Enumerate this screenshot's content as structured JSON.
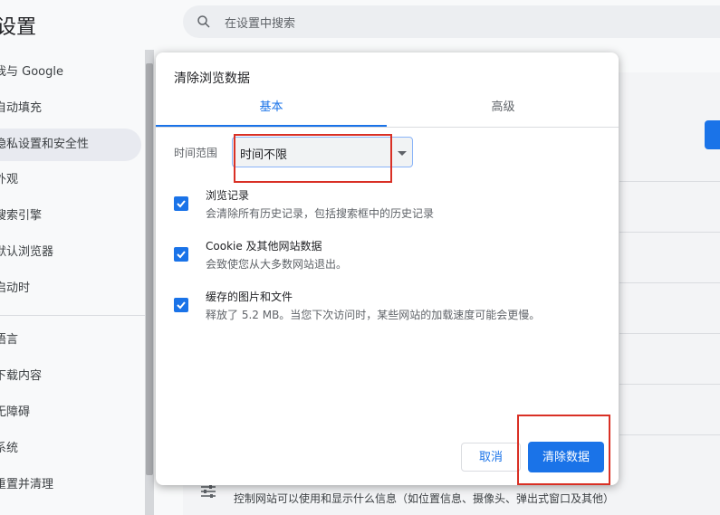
{
  "settings": {
    "title": "设置",
    "search_placeholder": "在设置中搜索",
    "sidebar": [
      {
        "label": "我与 Google"
      },
      {
        "label": "自动填充"
      },
      {
        "label": "隐私设置和安全性",
        "active": true
      },
      {
        "label": "外观"
      },
      {
        "label": "搜索引擎"
      },
      {
        "label": "默认浏览器"
      },
      {
        "label": "启动时"
      },
      {
        "label": "语言"
      },
      {
        "label": "下载内容"
      },
      {
        "label": "无障碍"
      },
      {
        "label": "系统"
      },
      {
        "label": "重置并清理"
      }
    ],
    "bottom_text": "控制网站可以使用和显示什么信息（如位置信息、摄像头、弹出式窗口及其他）"
  },
  "dialog": {
    "title": "清除浏览数据",
    "tabs": [
      {
        "label": "基本",
        "active": true
      },
      {
        "label": "高级",
        "active": false
      }
    ],
    "time_range_label": "时间范围",
    "time_range_value": "时间不限",
    "options": [
      {
        "title": "浏览记录",
        "desc": "会清除所有历史记录，包括搜索框中的历史记录",
        "checked": true
      },
      {
        "title": "Cookie 及其他网站数据",
        "desc": "会致使您从大多数网站退出。",
        "checked": true
      },
      {
        "title": "缓存的图片和文件",
        "desc": "释放了 5.2 MB。当您下次访问时，某些网站的加载速度可能会更慢。",
        "checked": true
      }
    ],
    "cancel_label": "取消",
    "clear_label": "清除数据"
  },
  "colors": {
    "accent": "#1a73e8",
    "highlight": "#d93025"
  }
}
